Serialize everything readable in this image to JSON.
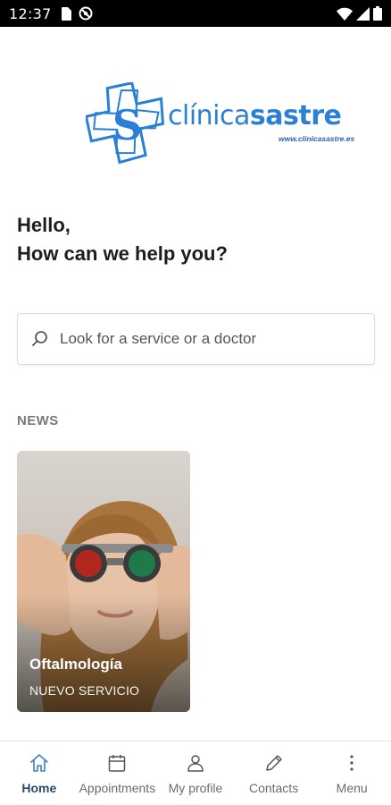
{
  "status_bar": {
    "time": "12:37"
  },
  "brand": {
    "name_light": "clínica",
    "name_bold": "sastre",
    "url": "www.clinicasastre.es",
    "letter": "S",
    "color": "#2a7fd6"
  },
  "greeting": {
    "line1": "Hello,",
    "line2": "How can we help you?"
  },
  "search": {
    "placeholder": "Look for a service or a doctor",
    "icon": "search-icon"
  },
  "news": {
    "section_label": "NEWS",
    "cards": [
      {
        "title": "Oftalmología",
        "subtitle": "NUEVO SERVICIO"
      }
    ]
  },
  "bottom_nav": {
    "items": [
      {
        "label": "Home",
        "icon": "home-icon",
        "active": true
      },
      {
        "label": "Appointments",
        "icon": "calendar-icon",
        "active": false
      },
      {
        "label": "My profile",
        "icon": "person-icon",
        "active": false
      },
      {
        "label": "Contacts",
        "icon": "pencil-icon",
        "active": false
      },
      {
        "label": "Menu",
        "icon": "more-vertical-icon",
        "active": false
      }
    ]
  },
  "colors": {
    "active_nav": "#2a4a6b",
    "inactive_nav": "#6b6b6b",
    "brand_blue": "#2a7fd6"
  }
}
